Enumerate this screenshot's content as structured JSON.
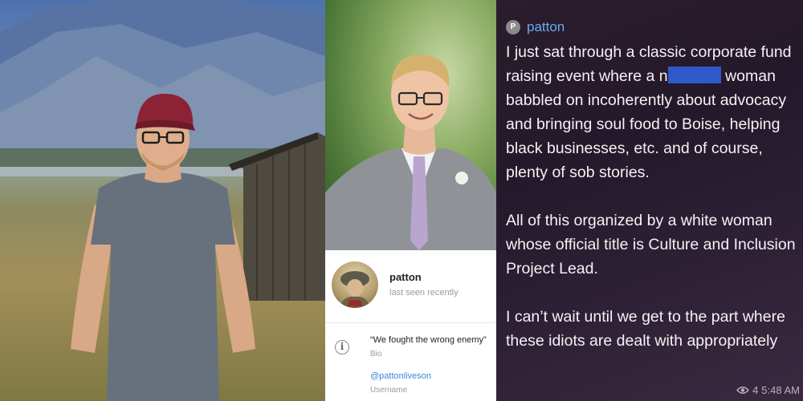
{
  "profile": {
    "name": "patton",
    "status": "last seen recently",
    "bio": "“We fought the wrong enemy”",
    "bio_label": "Bio",
    "username": "@pattonliveson",
    "username_label": "Username",
    "info_icon": "info-icon"
  },
  "message": {
    "sender_initial": "P",
    "sender_name": "patton",
    "para1_pre": "I just sat through a classic corporate fund raising event where a n",
    "para1_post": "woman babbled on incoherently about advocacy and bringing soul food to Boise, helping black businesses, etc. and of course, plenty of sob stories.",
    "para2": "All of this organized by a white woman whose official title is Culture and Inclusion Project Lead.",
    "para3": "I can’t wait until we get to the part where these idiots are dealt with appropriately",
    "views": "4",
    "time": "5:48 AM",
    "views_icon": "eye-icon"
  },
  "colors": {
    "username_link": "#3b86d6",
    "sender_name": "#6aaaf0",
    "redaction": "#2f59c9",
    "message_bg": "#24192a"
  }
}
